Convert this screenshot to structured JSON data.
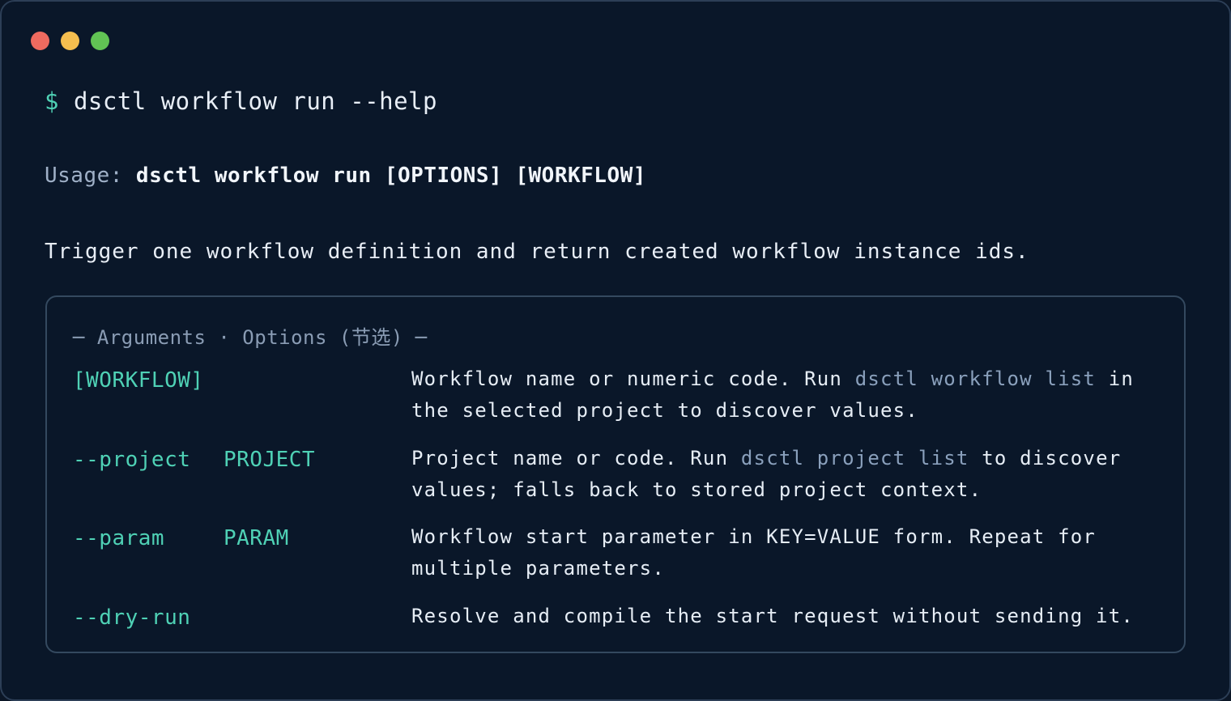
{
  "window": {
    "traffic_lights": [
      {
        "name": "close",
        "color": "#ee6a5f"
      },
      {
        "name": "minimize",
        "color": "#f5be4f"
      },
      {
        "name": "maximize",
        "color": "#61c354"
      }
    ]
  },
  "colors": {
    "background": "#0a1729",
    "accent": "#4fd1b5",
    "muted": "#8aa0bc",
    "text": "#e6edf5"
  },
  "prompt": {
    "symbol": "$",
    "command": "dsctl workflow run --help"
  },
  "usage": {
    "label": "Usage:",
    "syntax": "dsctl workflow run [OPTIONS] [WORKFLOW]"
  },
  "description": "Trigger one workflow definition and return created workflow instance ids.",
  "panel": {
    "title": "─ Arguments · Options (节选) ─",
    "rows": [
      {
        "name": "[WORKFLOW]",
        "meta": "",
        "desc_parts": [
          "Workflow name or numeric code. Run ",
          "dsctl workflow list",
          " in the selected project to discover values."
        ]
      },
      {
        "name": "--project",
        "meta": "PROJECT",
        "desc_parts": [
          "Project name or code. Run ",
          "dsctl project list",
          " to discover values; falls back to stored project context."
        ]
      },
      {
        "name": "--param",
        "meta": "PARAM",
        "desc_parts": [
          "Workflow start parameter in KEY=VALUE form. Repeat for multiple parameters.",
          "",
          ""
        ]
      },
      {
        "name": "--dry-run",
        "meta": "",
        "desc_parts": [
          "Resolve and compile the start request without sending it.",
          "",
          ""
        ]
      }
    ]
  }
}
